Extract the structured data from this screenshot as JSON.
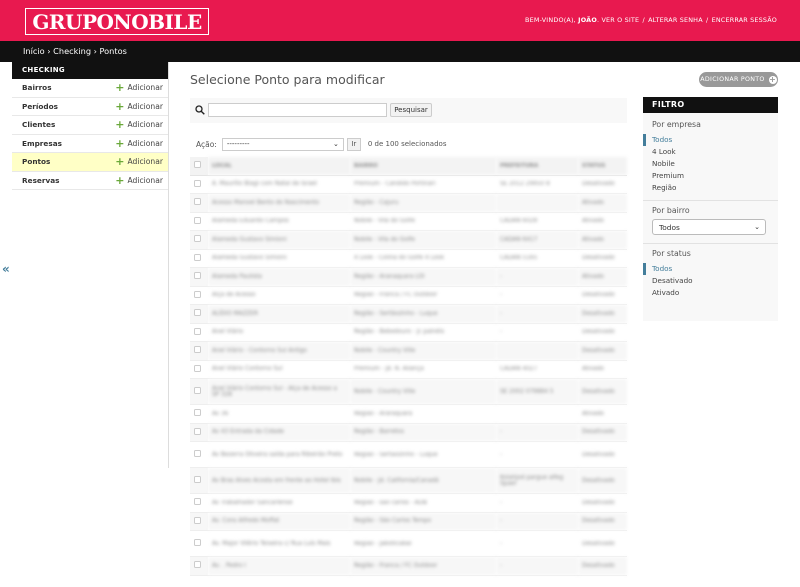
{
  "header": {
    "logo_text": "GRUPONOBILE",
    "welcome": "BEM-VINDO(A),",
    "username": "JOÃO",
    "links": [
      "VER O SITE",
      "ALTERAR SENHA",
      "ENCERRAR SESSÃO"
    ],
    "separator": "/",
    "bg_color": "#e8194f"
  },
  "breadcrumbs": [
    "Início",
    "Checking",
    "Pontos"
  ],
  "breadcrumb_sep": "›",
  "sidebar": {
    "caption": "CHECKING",
    "add_label": "Adicionar",
    "items": [
      {
        "label": "Bairros"
      },
      {
        "label": "Períodos"
      },
      {
        "label": "Clientes"
      },
      {
        "label": "Empresas"
      },
      {
        "label": "Pontos",
        "active": true
      },
      {
        "label": "Reservas"
      }
    ],
    "collapse_glyph": "«"
  },
  "main": {
    "title": "Selecione Ponto para modificar",
    "add_button": "ADICIONAR PONTO",
    "search_button": "Pesquisar",
    "search_value": "",
    "action_label": "Ação:",
    "action_selected": "---------",
    "go_button": "Ir",
    "selected_count": "0 de 100 selecionados"
  },
  "table": {
    "headers": [
      "LOCAL",
      "BAIRRO",
      "PREFEITURA",
      "STATUS"
    ],
    "rows": [
      [
        "A. Maurílio Biagi com Natal de Israel",
        "Premium - Candido Portinari",
        "SE 2012 29950 8",
        "Desativado"
      ],
      [
        "Acesso Manoel Bento do Nascimento",
        "Região - Cajuru",
        "",
        "Ativado"
      ],
      [
        "Alameda Eduardo Campos",
        "Nobile - Vila do Golfe",
        "CADAN 6028",
        "Ativado"
      ],
      [
        "Alameda Gustavo Simioni",
        "Nobile - Vila do Golfe",
        "CADAN 6417",
        "Ativado"
      ],
      [
        "Alameda Gustavo Simioni",
        "4 Look - Colina do Golfe 4 Look",
        "CADAN 5165",
        "Desativado"
      ],
      [
        "Alameda Paulista",
        "Região - Aranaquara LOI",
        "-",
        "Ativado"
      ],
      [
        "Alça de Acesso",
        "Região - Franca / FC Outdoor",
        "-",
        "Desativado"
      ],
      [
        "ALÍDIO MAZZER",
        "Região - Sertãozinho - Luque",
        "-",
        "Desativado"
      ],
      [
        "Anel Viário",
        "Região - Bebedouro - jc painéis",
        "-",
        "Desativado"
      ],
      [
        "Anel Viário - Contorno Sul Antigo",
        "Nobile - Country Ville",
        "",
        "Desativado"
      ],
      [
        "Anel Viário Contorno Sul",
        "Premium - Jd. N. Aliança",
        "CADAN 4027",
        "Ativado"
      ],
      [
        "Anel Viário Contorno Sul - Alça de Acesso a SP 328",
        "Nobile - Country Ville",
        "SE 2002 079884 5",
        "Desativado"
      ],
      [
        "Av 36",
        "Região - Araraquara",
        "",
        "Ativado"
      ],
      [
        "Av 43 Entrada da Cidade",
        "Região - Barretos",
        "-",
        "Desativado"
      ],
      [
        "Av Bezerra Oliveira saída para Ribeirão Preto",
        "Região - Sertãozinho - Luque",
        "-",
        "Desativado"
      ],
      [
        "Av Bras Alves Acosta em frente ao Hotel Ibis",
        "Nobile - Jd. California/Canadá",
        "Kolahjod pargue alfeg Spaer",
        "Desativado"
      ],
      [
        "Av Trabalhador Sancarlense",
        "Região - são carlos - ADB",
        "-",
        "Desativado"
      ],
      [
        "Av. Cons Alfredo Moffat",
        "Região - São Carlos Tempo",
        "-",
        "Desativado"
      ],
      [
        "Av. Major Viiêrio Teixeira c/ Rua Luís Mais",
        "Região - Jaboticabal",
        "-",
        "Desativado"
      ],
      [
        "Av. . Pedro I",
        "Região - Franca / FC Outdoor",
        "-",
        "Desativado"
      ]
    ]
  },
  "filter": {
    "title": "FILTRO",
    "by_company": {
      "heading": "Por empresa",
      "options": [
        "Todos",
        "4 Look",
        "Nobile",
        "Premium",
        "Região"
      ],
      "selected": 0
    },
    "by_bairro": {
      "heading": "Por bairro",
      "selected_value": "Todos"
    },
    "by_status": {
      "heading": "Por status",
      "options": [
        "Todos",
        "Desativado",
        "Ativado"
      ],
      "selected": 0
    }
  },
  "colors": {
    "header": "#e8194f",
    "dark_bar": "#111111",
    "active_row": "#ffffc6",
    "add_plus": "#6aa83a",
    "link_blue": "#447e9b"
  }
}
